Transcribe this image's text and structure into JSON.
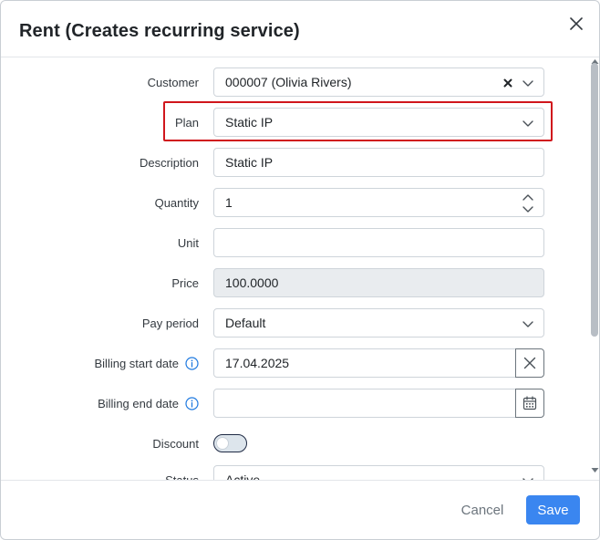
{
  "dialog": {
    "title": "Rent (Creates recurring service)"
  },
  "form": {
    "customer": {
      "label": "Customer",
      "value": "000007 (Olivia Rivers)"
    },
    "plan": {
      "label": "Plan",
      "value": "Static IP"
    },
    "description": {
      "label": "Description",
      "value": "Static IP"
    },
    "quantity": {
      "label": "Quantity",
      "value": "1"
    },
    "unit": {
      "label": "Unit",
      "value": ""
    },
    "price": {
      "label": "Price",
      "value": "100.0000"
    },
    "pay_period": {
      "label": "Pay period",
      "value": "Default"
    },
    "billing_start_date": {
      "label": "Billing start date",
      "value": "17.04.2025"
    },
    "billing_end_date": {
      "label": "Billing end date",
      "value": ""
    },
    "discount": {
      "label": "Discount",
      "enabled": false
    },
    "status": {
      "label": "Status",
      "value": "Active"
    }
  },
  "footer": {
    "cancel_label": "Cancel",
    "save_label": "Save"
  },
  "colors": {
    "primary": "#3a86f0",
    "highlight": "#d0161c",
    "info_icon": "#1f7ae0"
  },
  "icons": {
    "close": "close-icon",
    "chevron": "chevron-down-icon",
    "clear": "clear-x-icon",
    "info": "info-icon",
    "calendar": "calendar-icon"
  }
}
